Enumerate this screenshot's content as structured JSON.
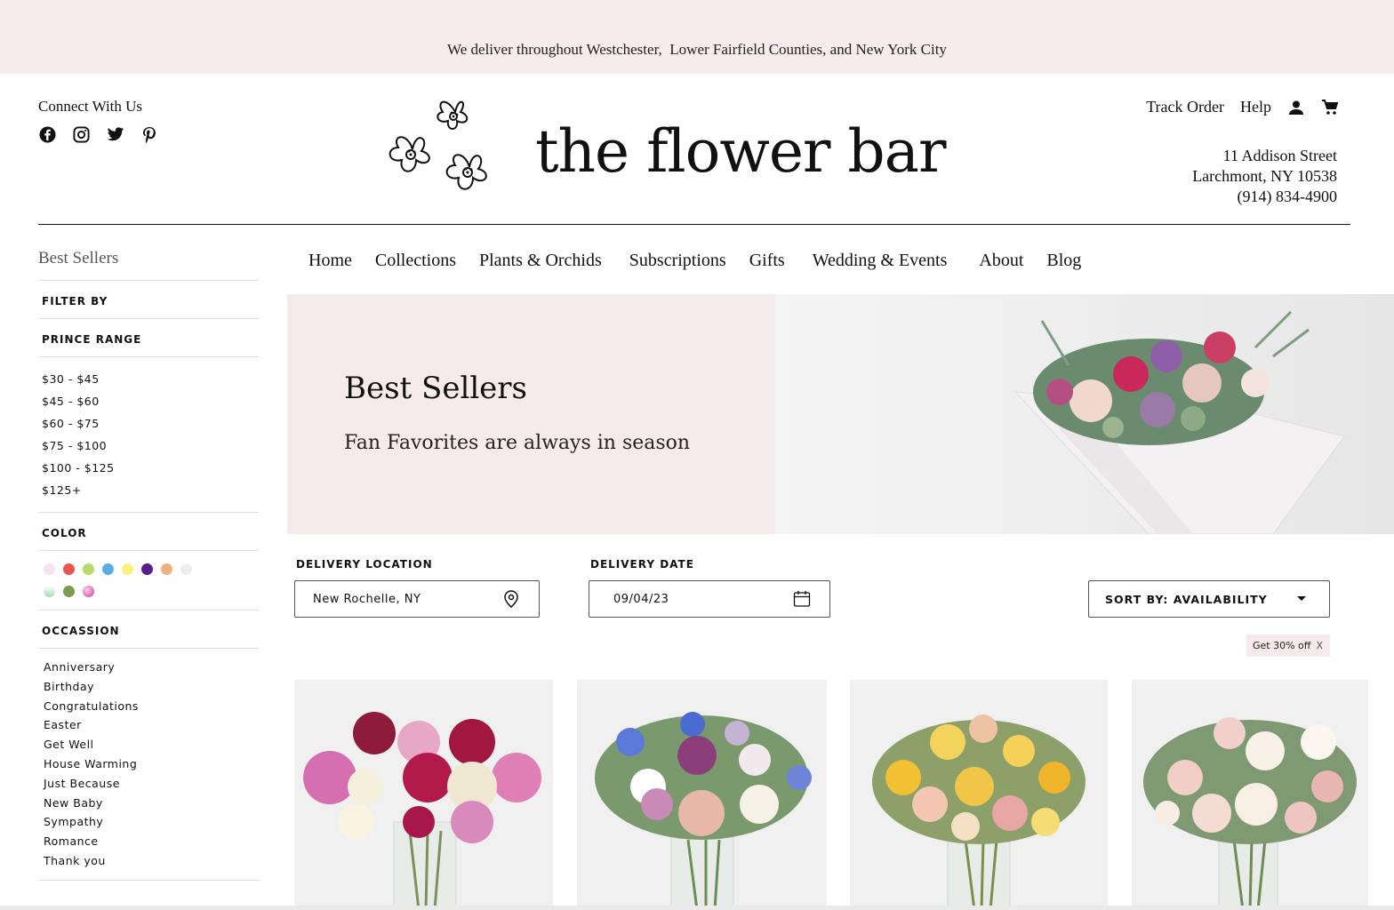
{
  "announcement": "We deliver throughout Westchester,  Lower Fairfield Counties, and New York City",
  "connect": {
    "title": "Connect With Us",
    "icons": [
      "facebook-icon",
      "instagram-icon",
      "twitter-icon",
      "pinterest-icon"
    ]
  },
  "brand": {
    "name": "the flower bar"
  },
  "topnav": {
    "track_order": "Track Order",
    "help": "Help",
    "icons": [
      "account-icon",
      "cart-icon"
    ]
  },
  "address": {
    "line1": "11 Addison Street",
    "line2": "Larchmont, NY 10538",
    "phone": "(914) 834-4900"
  },
  "sidebar": {
    "title": "Best Sellers",
    "filter_by": "FILTER BY",
    "price_heading": "PRINCE RANGE",
    "prices": [
      "$30 - $45",
      "$45 - $60",
      "$60 - $75",
      "$75 - $100",
      "$100 - $125",
      "$125+"
    ],
    "color_heading": "COLOR",
    "colors_row1": [
      "#f8e1f3",
      "#e9544f",
      "#b5dc6a",
      "#5aaee6",
      "#f9f27a",
      "#5b1d8f",
      "#f1b07e",
      "#eeeeee"
    ],
    "colors_row2": [
      "gradient-green-white",
      "#7b9b4f",
      "gradient-pink"
    ],
    "occasion_heading": "OCCASSION",
    "occasions": [
      "Anniversary",
      "Birthday",
      "Congratulations",
      "Easter",
      "Get Well",
      "House Warming",
      "Just Because",
      "New Baby",
      "Sympathy",
      "Romance",
      "Thank you"
    ]
  },
  "mainnav": [
    "Home",
    "Collections",
    "Plants & Orchids",
    "Subscriptions",
    "Gifts",
    "Wedding & Events",
    "About",
    "Blog"
  ],
  "hero": {
    "title": "Best Sellers",
    "subtitle": "Fan Favorites are always in season"
  },
  "delivery": {
    "location_label": "DELIVERY LOCATION",
    "location_value": "New Rochelle, NY",
    "date_label": "DELIVERY DATE",
    "date_value": "09/04/23",
    "sort_value": "SORT BY: AVAILABILITY"
  },
  "promo": {
    "text": "Get 30% off",
    "close": "X"
  },
  "products": [
    {
      "name": "peony-bouquet"
    },
    {
      "name": "mixed-garden-bouquet"
    },
    {
      "name": "yellow-peach-bouquet"
    },
    {
      "name": "blush-rose-bouquet"
    }
  ],
  "colors": {
    "announce_bg": "#f6eced",
    "hero_pink": "#f6ebec",
    "text": "#111111"
  }
}
